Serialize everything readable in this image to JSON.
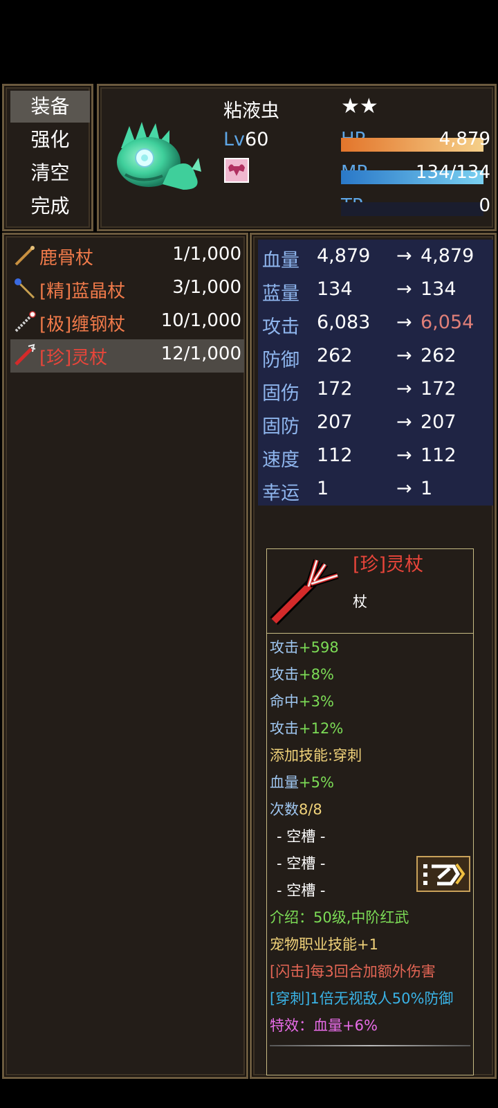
{
  "menu": {
    "items": [
      "装备",
      "强化",
      "清空",
      "完成"
    ],
    "selected_index": 0
  },
  "pet": {
    "name": "粘液虫",
    "stars": "★★",
    "level_prefix": "Lv",
    "level": "60",
    "hp_label": "HP",
    "hp_value": "4,879",
    "hp_fill": 1.0,
    "mp_label": "MP",
    "mp_value": "134/134",
    "mp_fill": 1.0,
    "tp_label": "TP",
    "tp_value": "0",
    "tp_fill": 0.0,
    "sprite_icon": "green-slime-worm-icon",
    "status_icon": "muscle-buff-icon"
  },
  "item_list": [
    {
      "name": "鹿骨杖",
      "count": "1/1,000",
      "color": "#f07a4a",
      "icon": "bone-staff-icon"
    },
    {
      "name": "[精]蓝晶杖",
      "count": "3/1,000",
      "color": "#f07a4a",
      "icon": "blue-crystal-staff-icon"
    },
    {
      "name": "[极]缠钢杖",
      "count": "10/1,000",
      "color": "#f07a4a",
      "icon": "steel-staff-icon"
    },
    {
      "name": "[珍]灵杖",
      "count": "12/1,000",
      "color": "#e8453a",
      "icon": "spirit-staff-icon",
      "selected": true
    }
  ],
  "stats": [
    {
      "name": "血量",
      "before": "4,879",
      "arrow": "→",
      "after": "4,879",
      "change": "same"
    },
    {
      "name": "蓝量",
      "before": "134",
      "arrow": "→",
      "after": "134",
      "change": "same"
    },
    {
      "name": "攻击",
      "before": "6,083",
      "arrow": "→",
      "after": "6,054",
      "change": "down"
    },
    {
      "name": "防御",
      "before": "262",
      "arrow": "→",
      "after": "262",
      "change": "same"
    },
    {
      "name": "固伤",
      "before": "172",
      "arrow": "→",
      "after": "172",
      "change": "same"
    },
    {
      "name": "固防",
      "before": "207",
      "arrow": "→",
      "after": "207",
      "change": "same"
    },
    {
      "name": "速度",
      "before": "112",
      "arrow": "→",
      "after": "112",
      "change": "same"
    },
    {
      "name": "幸运",
      "before": "1",
      "arrow": "→",
      "after": "1",
      "change": "same"
    }
  ],
  "detail": {
    "item_name": "[珍]灵杖",
    "item_type": "杖",
    "item_icon": "spirit-staff-icon",
    "props": [
      {
        "label": "攻击",
        "value": "+598"
      },
      {
        "label": "攻击",
        "value": "+8%"
      },
      {
        "label": "命中",
        "value": "+3%"
      },
      {
        "label": "攻击",
        "value": "+12%"
      }
    ],
    "skill_add": "添加技能:穿刺",
    "hp_prop": {
      "label": "血量",
      "value": "+5%"
    },
    "uses": {
      "label": "次数",
      "value": "8/8"
    },
    "slots": [
      "- 空槽 -",
      "- 空槽 -",
      "- 空槽 -"
    ],
    "intro": "介绍：50级,中阶红武",
    "pet_skill": "宠物职业技能+1",
    "flash": "[闪击]每3回合加额外伤害",
    "pierce": "[穿刺]1倍无视敌人50%防御",
    "special": "特效：血量+6%",
    "action_icon": "equip-arrow-icon"
  }
}
